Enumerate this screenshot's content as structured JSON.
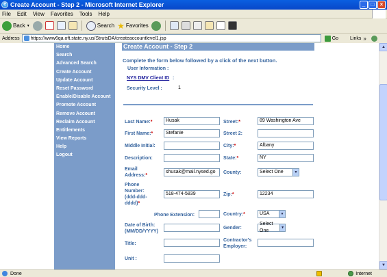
{
  "window": {
    "title": "Create Account - Step 2 - Microsoft Internet Explorer",
    "controls": [
      "_",
      "□",
      "×"
    ]
  },
  "menu": [
    "File",
    "Edit",
    "View",
    "Favorites",
    "Tools",
    "Help"
  ],
  "toolbar": {
    "back": "Back",
    "search": "Search",
    "favorites": "Favorites"
  },
  "address": {
    "label": "Address",
    "url": "https://www6qa.oft.state.ny.us/StrutsDA/createaccountlevel1.jsp",
    "go": "Go",
    "links": "Links"
  },
  "sidebar": {
    "items": [
      "Home",
      "Search",
      "Advanced Search",
      "Create Account",
      "Update Account",
      "Reset Password",
      "Enable/Disable Account",
      "Promote Account",
      "Remove Account",
      "Reclaim Account",
      "Entitlements",
      "View Reports",
      "Help",
      "Logout"
    ]
  },
  "page": {
    "title": "Create Account - Step 2",
    "instructions": "Complete the form below followed by a click of the next button.",
    "user_info_label": "User Information :",
    "client_id_label": "NYS DMV Client ID",
    "client_id_colon": ":",
    "security_level_label": "Security Level :",
    "security_level_value": "1"
  },
  "form": {
    "last_name": {
      "label": "Last Name:",
      "value": "Husak"
    },
    "first_name": {
      "label": "First Name:",
      "value": "Stefanie"
    },
    "middle_initial": {
      "label": "Middle Initial:",
      "value": ""
    },
    "description": {
      "label": "Description:",
      "value": ""
    },
    "email": {
      "label": "Email Address:",
      "value": "shusak@mail.nysed.go"
    },
    "phone": {
      "label": "Phone Number: (ddd-ddd-dddd)",
      "value": "518-474-5839"
    },
    "phone_ext": {
      "label": "Phone Extension:",
      "value": ""
    },
    "dob": {
      "label": "Date of Birth: (MM/DD/YYYY)",
      "value": ""
    },
    "title": {
      "label": "Title:",
      "value": ""
    },
    "unit": {
      "label": "Unit :",
      "value": ""
    },
    "street": {
      "label": "Street:",
      "value": "89 Washington Ave"
    },
    "street2": {
      "label": "Street 2:",
      "value": ""
    },
    "city": {
      "label": "City:",
      "value": "Albany"
    },
    "state": {
      "label": "State:",
      "value": "NY"
    },
    "county": {
      "label": "County:",
      "value": "Select One"
    },
    "zip": {
      "label": "Zip:",
      "value": "12234"
    },
    "country": {
      "label": "Country:",
      "value": "USA"
    },
    "gender": {
      "label": "Gender:",
      "value": "Select One"
    },
    "contractor": {
      "label": "Contractor's Employer:",
      "value": ""
    },
    "required_mark": "*"
  },
  "status": {
    "text": "Done",
    "zone": "Internet"
  },
  "colors": {
    "sidebar": "#7b9cc9",
    "label": "#36649e",
    "titlebar": "#0a5fe0"
  }
}
